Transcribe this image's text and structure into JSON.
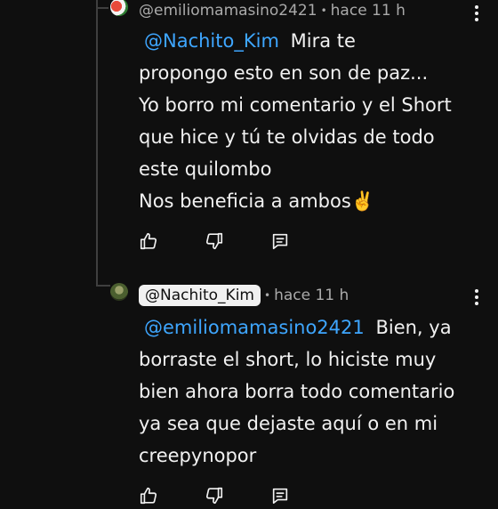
{
  "comments": [
    {
      "author": "@emiliomamasino2421",
      "time": "hace 11 h",
      "mention": "@Nachito_Kim",
      "lines": [
        "Mira te",
        "propongo esto en son de paz...",
        "Yo borro mi comentario y el Short",
        "que hice y tú te olvidas de todo",
        "este quilombo",
        "Nos beneficia a ambos✌️"
      ]
    },
    {
      "author": "@Nachito_Kim",
      "time": "hace 11 h",
      "mention": "@emiliomamasino2421",
      "lines": [
        "Bien, ya",
        "borraste el short, lo hiciste muy",
        "bien ahora borra todo comentario",
        "ya sea que dejaste aquí o en mi",
        "creepynopor"
      ]
    }
  ],
  "icons": {
    "like": "thumb-up-icon",
    "dislike": "thumb-down-icon",
    "reply": "reply-icon",
    "more": "more-vert-icon"
  },
  "colors": {
    "background": "#0f0f0f",
    "text": "#f1f1f1",
    "muted": "#aaaaaa",
    "mention": "#3ea6ff"
  }
}
